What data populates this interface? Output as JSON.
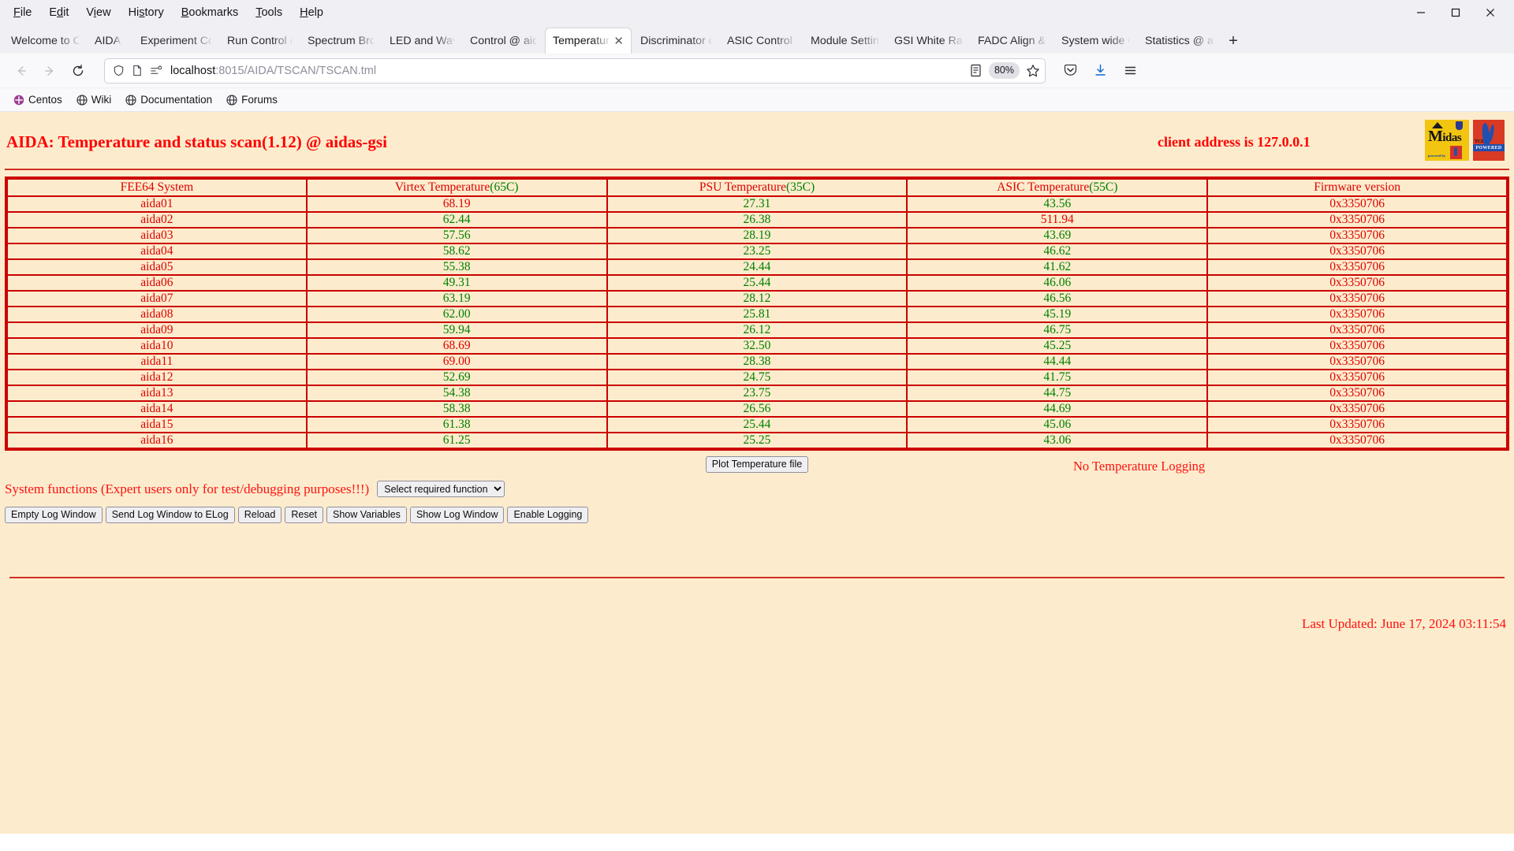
{
  "browser": {
    "menus": [
      {
        "label": "File",
        "accel": "F"
      },
      {
        "label": "Edit",
        "accel": "E"
      },
      {
        "label": "View",
        "accel": "V"
      },
      {
        "label": "History",
        "accel": "s"
      },
      {
        "label": "Bookmarks",
        "accel": "B"
      },
      {
        "label": "Tools",
        "accel": "T"
      },
      {
        "label": "Help",
        "accel": "H"
      }
    ],
    "window_controls": {
      "minimize": "─",
      "maximize": "☐",
      "close": "✕"
    },
    "tabs": [
      {
        "label": "Welcome to Cen",
        "active": false
      },
      {
        "label": "AIDA",
        "active": false
      },
      {
        "label": "Experiment Cont",
        "active": false
      },
      {
        "label": "Run Control @ a",
        "active": false
      },
      {
        "label": "Spectrum Brows",
        "active": false
      },
      {
        "label": "LED and Wavefo",
        "active": false
      },
      {
        "label": "Control @ aidas",
        "active": false
      },
      {
        "label": "Temperature a",
        "active": true
      },
      {
        "label": "Discriminator co",
        "active": false
      },
      {
        "label": "ASIC Control @",
        "active": false
      },
      {
        "label": "Module Settings",
        "active": false
      },
      {
        "label": "GSI White Rabbi",
        "active": false
      },
      {
        "label": "FADC Align & Co",
        "active": false
      },
      {
        "label": "System wide Che",
        "active": false
      },
      {
        "label": "Statistics @ aida",
        "active": false
      }
    ],
    "new_tab_label": "+",
    "tab_close_label": "✕",
    "nav": {
      "back": "←",
      "forward": "→",
      "reload": "⟳"
    },
    "url": {
      "prefix": "localhost",
      "rest": ":8015/AIDA/TSCAN/TSCAN.tml"
    },
    "zoom_level": "80%",
    "bookmarks": [
      {
        "label": "Centos",
        "icon": "centos-icon"
      },
      {
        "label": "Wiki",
        "icon": "globe-icon"
      },
      {
        "label": "Documentation",
        "icon": "globe-icon"
      },
      {
        "label": "Forums",
        "icon": "globe-icon"
      }
    ]
  },
  "page": {
    "title": "AIDA: Temperature and status scan(1.12) @ aidas-gsi",
    "client_address": "client address is 127.0.0.1",
    "logos": {
      "midas": {
        "text_big": "M",
        "text_rest": "idas",
        "sub": "powered by"
      },
      "tcl": {
        "label": "TCL",
        "band": "POWERED"
      }
    },
    "table": {
      "headers": [
        {
          "main": "FEE64 System",
          "limit": ""
        },
        {
          "main": "Virtex Temperature",
          "limit": "(65C)"
        },
        {
          "main": "PSU Temperature",
          "limit": "(35C)"
        },
        {
          "main": "ASIC Temperature",
          "limit": "(55C)"
        },
        {
          "main": "Firmware version",
          "limit": ""
        }
      ],
      "rows": [
        {
          "system": "aida01",
          "virtex": "68.19",
          "virtex_state": "red",
          "psu": "27.31",
          "psu_state": "green",
          "asic": "43.56",
          "asic_state": "green",
          "firmware": "0x3350706"
        },
        {
          "system": "aida02",
          "virtex": "62.44",
          "virtex_state": "green",
          "psu": "26.38",
          "psu_state": "green",
          "asic": "511.94",
          "asic_state": "red",
          "firmware": "0x3350706"
        },
        {
          "system": "aida03",
          "virtex": "57.56",
          "virtex_state": "green",
          "psu": "28.19",
          "psu_state": "green",
          "asic": "43.69",
          "asic_state": "green",
          "firmware": "0x3350706"
        },
        {
          "system": "aida04",
          "virtex": "58.62",
          "virtex_state": "green",
          "psu": "23.25",
          "psu_state": "green",
          "asic": "46.62",
          "asic_state": "green",
          "firmware": "0x3350706"
        },
        {
          "system": "aida05",
          "virtex": "55.38",
          "virtex_state": "green",
          "psu": "24.44",
          "psu_state": "green",
          "asic": "41.62",
          "asic_state": "green",
          "firmware": "0x3350706"
        },
        {
          "system": "aida06",
          "virtex": "49.31",
          "virtex_state": "green",
          "psu": "25.44",
          "psu_state": "green",
          "asic": "46.06",
          "asic_state": "green",
          "firmware": "0x3350706"
        },
        {
          "system": "aida07",
          "virtex": "63.19",
          "virtex_state": "green",
          "psu": "28.12",
          "psu_state": "green",
          "asic": "46.56",
          "asic_state": "green",
          "firmware": "0x3350706"
        },
        {
          "system": "aida08",
          "virtex": "62.00",
          "virtex_state": "green",
          "psu": "25.81",
          "psu_state": "green",
          "asic": "45.19",
          "asic_state": "green",
          "firmware": "0x3350706"
        },
        {
          "system": "aida09",
          "virtex": "59.94",
          "virtex_state": "green",
          "psu": "26.12",
          "psu_state": "green",
          "asic": "46.75",
          "asic_state": "green",
          "firmware": "0x3350706"
        },
        {
          "system": "aida10",
          "virtex": "68.69",
          "virtex_state": "red",
          "psu": "32.50",
          "psu_state": "green",
          "asic": "45.25",
          "asic_state": "green",
          "firmware": "0x3350706"
        },
        {
          "system": "aida11",
          "virtex": "69.00",
          "virtex_state": "red",
          "psu": "28.38",
          "psu_state": "green",
          "asic": "44.44",
          "asic_state": "green",
          "firmware": "0x3350706"
        },
        {
          "system": "aida12",
          "virtex": "52.69",
          "virtex_state": "green",
          "psu": "24.75",
          "psu_state": "green",
          "asic": "41.75",
          "asic_state": "green",
          "firmware": "0x3350706"
        },
        {
          "system": "aida13",
          "virtex": "54.38",
          "virtex_state": "green",
          "psu": "23.75",
          "psu_state": "green",
          "asic": "44.75",
          "asic_state": "green",
          "firmware": "0x3350706"
        },
        {
          "system": "aida14",
          "virtex": "58.38",
          "virtex_state": "green",
          "psu": "26.56",
          "psu_state": "green",
          "asic": "44.69",
          "asic_state": "green",
          "firmware": "0x3350706"
        },
        {
          "system": "aida15",
          "virtex": "61.38",
          "virtex_state": "green",
          "psu": "25.44",
          "psu_state": "green",
          "asic": "45.06",
          "asic_state": "green",
          "firmware": "0x3350706"
        },
        {
          "system": "aida16",
          "virtex": "61.25",
          "virtex_state": "green",
          "psu": "25.25",
          "psu_state": "green",
          "asic": "43.06",
          "asic_state": "green",
          "firmware": "0x3350706"
        }
      ]
    },
    "controls": {
      "plot_button": "Plot Temperature file",
      "logging_status": "No Temperature Logging",
      "sysfunc_label": "System functions (Expert users only for test/debugging purposes!!!)",
      "sysfunc_selected": "Select required function",
      "buttons": [
        "Empty Log Window",
        "Send Log Window to ELog",
        "Reload",
        "Reset",
        "Show Variables",
        "Show Log Window",
        "Enable Logging"
      ]
    },
    "last_updated": "Last Updated: June 17, 2024 03:11:54",
    "colors": {
      "background": "#fceccd",
      "accent_red": "#ff0000",
      "border_red": "#cc0000",
      "ok_green": "#008000"
    }
  }
}
